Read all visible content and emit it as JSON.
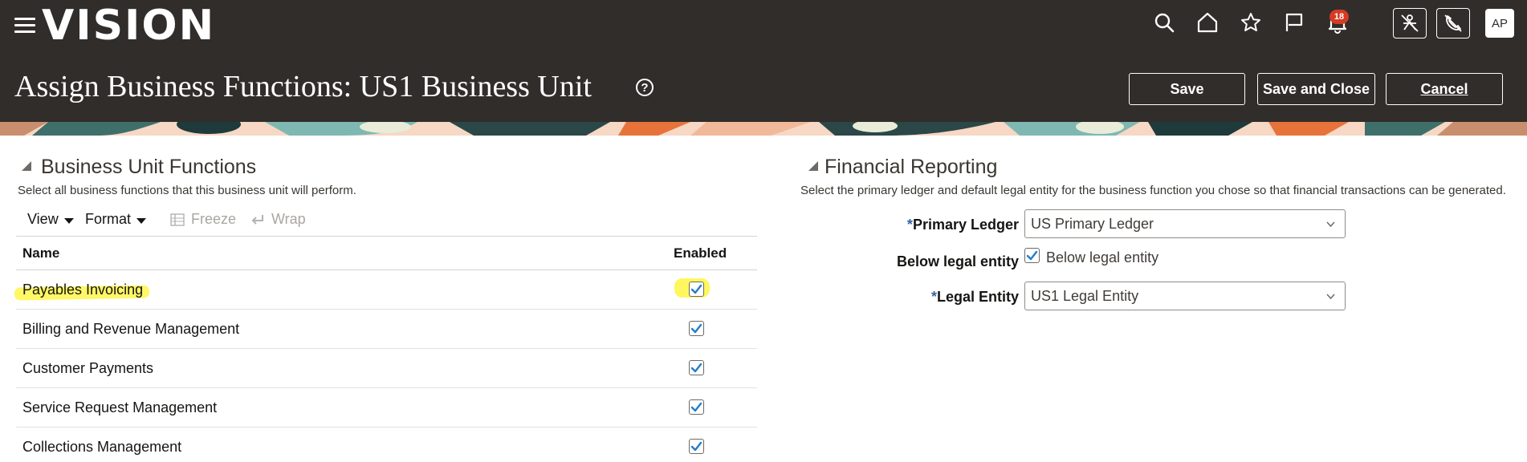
{
  "header": {
    "logo": "VISION",
    "notifications_count": "18",
    "avatar_initials": "AP",
    "page_title": "Assign Business Functions: US1 Business Unit",
    "help_symbol": "?",
    "buttons": {
      "save": "Save",
      "save_close": "Save and Close",
      "cancel": "Cancel"
    }
  },
  "left": {
    "title": "Business Unit Functions",
    "description": "Select all business functions that this business unit will perform.",
    "toolbar": {
      "view": "View",
      "format": "Format",
      "freeze": "Freeze",
      "wrap": "Wrap"
    },
    "columns": {
      "name": "Name",
      "enabled": "Enabled"
    },
    "rows": [
      {
        "name": "Payables Invoicing",
        "enabled": true
      },
      {
        "name": "Billing and Revenue Management",
        "enabled": true
      },
      {
        "name": "Customer Payments",
        "enabled": true
      },
      {
        "name": "Service Request Management",
        "enabled": true
      },
      {
        "name": "Collections Management",
        "enabled": true
      }
    ]
  },
  "right": {
    "title": "Financial Reporting",
    "description": "Select the primary ledger and default legal entity for the business function you chose so that financial transactions can be generated.",
    "primary_ledger": {
      "required_mark": "*",
      "label": "Primary Ledger",
      "value": "US Primary Ledger"
    },
    "below_legal_entity": {
      "label": "Below legal entity",
      "checkbox_label": "Below legal entity",
      "checked": true
    },
    "legal_entity": {
      "required_mark": "*",
      "label": "Legal Entity",
      "value": "US1 Legal Entity"
    }
  },
  "colors": {
    "header_bg": "#312d2a",
    "highlight": "#fff64b",
    "check": "#227ecb",
    "badge": "#d63b25",
    "required": "#3465a4"
  }
}
